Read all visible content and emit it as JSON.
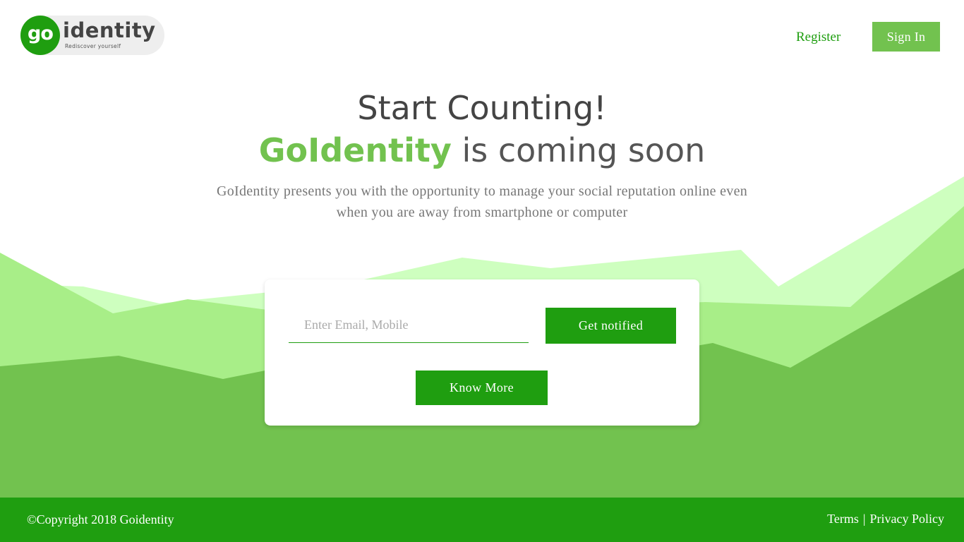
{
  "logo": {
    "badge": "go",
    "word": "identity",
    "tagline": "Rediscover yourself"
  },
  "nav": {
    "register": "Register",
    "sign_in": "Sign In"
  },
  "hero": {
    "title": "Start Counting!",
    "brand": "GoIdentity",
    "subtitle_rest": " is coming soon",
    "description": "GoIdentity presents you with the opportunity to manage your social reputation online even when you are away from smartphone or computer"
  },
  "form": {
    "input_placeholder": "Enter Email, Mobile",
    "input_value": "",
    "notify_button": "Get notified",
    "know_more_button": "Know More"
  },
  "footer": {
    "copyright": "©Copyright 2018 Goidentity",
    "terms": "Terms",
    "separator": "|",
    "privacy": "Privacy Policy"
  },
  "colors": {
    "primary_green": "#1f9e10",
    "accent_green": "#72c24f",
    "light_green": "#a8ee88",
    "pale_green": "#ceffbf"
  }
}
